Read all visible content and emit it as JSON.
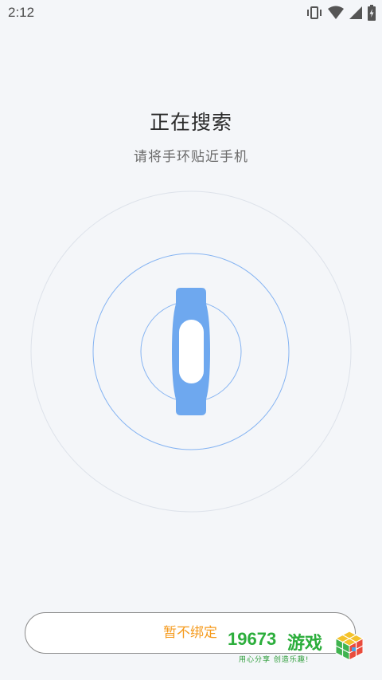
{
  "status_bar": {
    "time": "2:12",
    "icons": [
      "vibrate-icon",
      "wifi-icon",
      "signal-icon",
      "battery-charging-icon"
    ]
  },
  "search": {
    "title": "正在搜索",
    "subtitle": "请将手环贴近手机"
  },
  "radar": {
    "device_icon": "band-icon",
    "ring_color": "#7fb0f3",
    "outer_ring_color": "#d9dee6",
    "band_color": "#6aa6ef"
  },
  "actions": {
    "skip_label": "暂不绑定",
    "skip_color": "#f59a1c"
  },
  "watermark": {
    "number": "19673",
    "name": "游戏",
    "slogan": "用心分享 创造乐趣!",
    "logo_icon": "cube-logo-icon"
  }
}
